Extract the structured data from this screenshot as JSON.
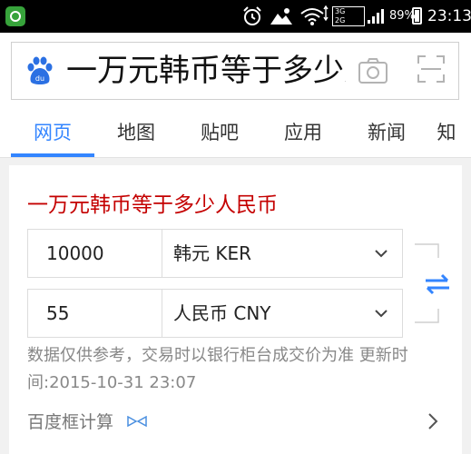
{
  "status_bar": {
    "battery_percent": "89%",
    "time": "23:13",
    "network_lines": [
      "3G",
      "2G"
    ],
    "icons": [
      "app-icon",
      "alarm-icon",
      "mountain-icon",
      "wifi-icon",
      "signal-icon",
      "battery-icon"
    ]
  },
  "search": {
    "query": "一万元韩币等于多少人民币",
    "icons": [
      "baidu-logo",
      "camera-icon",
      "scan-icon"
    ]
  },
  "tabs": [
    {
      "label": "网页",
      "active": true
    },
    {
      "label": "地图",
      "active": false
    },
    {
      "label": "贴吧",
      "active": false
    },
    {
      "label": "应用",
      "active": false
    },
    {
      "label": "新闻",
      "active": false
    },
    {
      "label": "知",
      "active": false
    }
  ],
  "converter": {
    "title": "一万元韩币等于多少人民币",
    "from": {
      "amount": "10000",
      "currency": "韩元 KER"
    },
    "to": {
      "amount": "55",
      "currency": "人民币 CNY"
    },
    "notice": "数据仅供参考，交易时以银行柜台成交价为准 更新时间:2015-10-31 23:07",
    "footer": "百度框计算"
  },
  "colors": {
    "accent": "#3385ff",
    "title_red": "#c40000",
    "status_bar": "#000000",
    "app_green": "#37a33b"
  }
}
